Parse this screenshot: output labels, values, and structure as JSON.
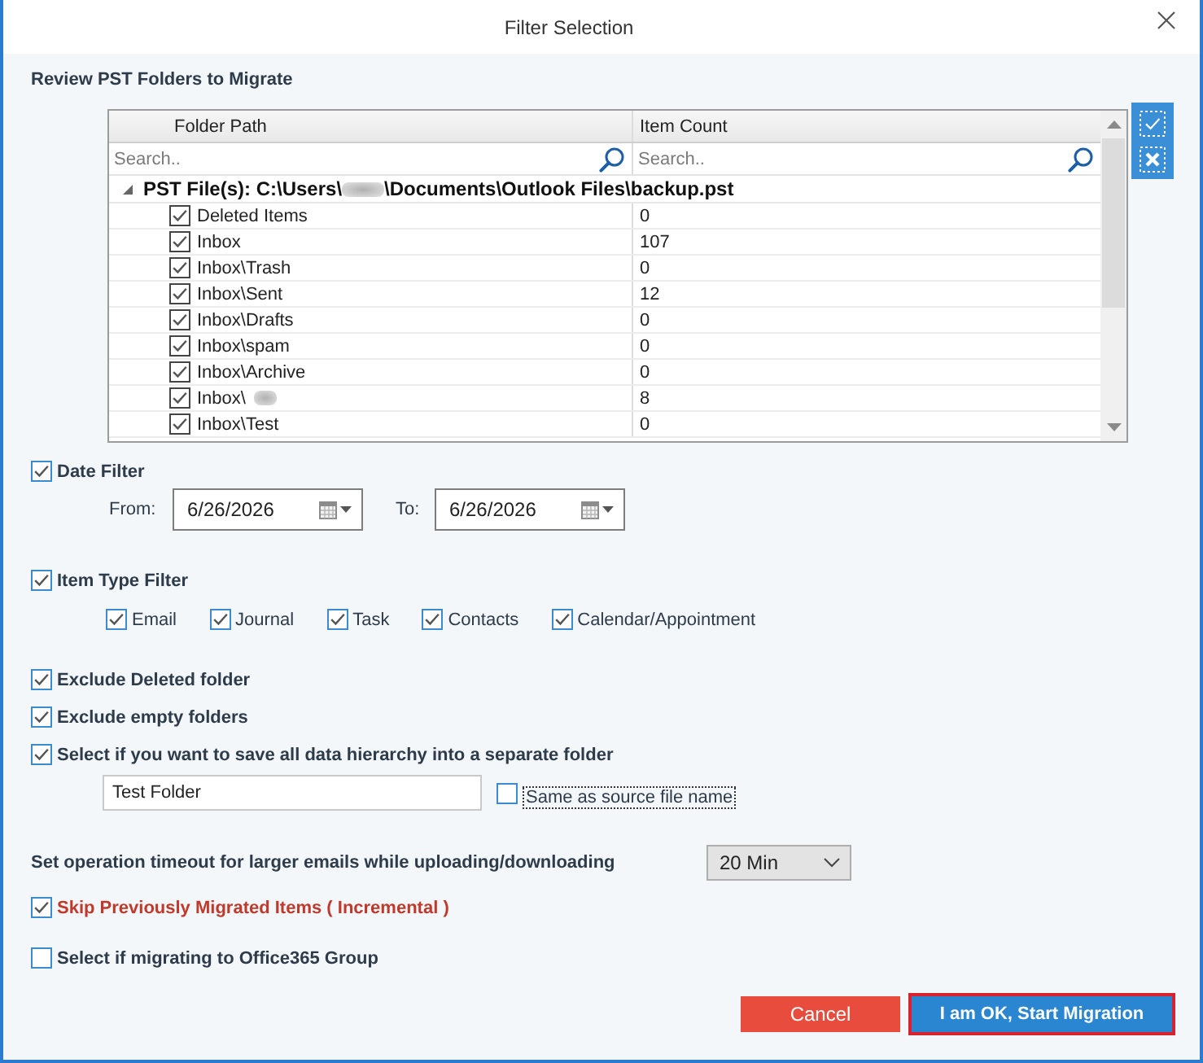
{
  "dialog": {
    "title": "Filter Selection"
  },
  "folders": {
    "heading": "Review PST Folders to Migrate",
    "columns": [
      "Folder Path",
      "Item Count"
    ],
    "search_placeholders": [
      "Search..",
      "Search.."
    ],
    "tree": {
      "expanded": true,
      "path_start": "PST File(s): C:\\Users\\",
      "blurred": true,
      "path_end": "\\Documents\\Outlook Files\\backup.pst",
      "children": [
        {
          "name": "Deleted Items",
          "count": "0",
          "checked": true,
          "blurred": false
        },
        {
          "name": "Inbox",
          "count": "107",
          "checked": true,
          "blurred": false
        },
        {
          "name": "Inbox\\Trash",
          "count": "0",
          "checked": true,
          "blurred": false
        },
        {
          "name": "Inbox\\Sent",
          "count": "12",
          "checked": true,
          "blurred": false
        },
        {
          "name": "Inbox\\Drafts",
          "count": "0",
          "checked": true,
          "blurred": false
        },
        {
          "name": "Inbox\\spam",
          "count": "0",
          "checked": true,
          "blurred": false
        },
        {
          "name": "Inbox\\Archive",
          "count": "0",
          "checked": true,
          "blurred": false
        },
        {
          "name": "Inbox\\",
          "count": "8",
          "checked": true,
          "blurred": true
        },
        {
          "name": "Inbox\\Test",
          "count": "0",
          "checked": true,
          "blurred": false
        }
      ]
    }
  },
  "date_filter": {
    "label": "Date Filter",
    "checked": true,
    "from_label": "From:",
    "from": "6/26/2026",
    "to_label": "To:",
    "to": "6/26/2026"
  },
  "item_type_filter": {
    "label": "Item Type Filter",
    "checked": true,
    "types": [
      {
        "label": "Email",
        "checked": true
      },
      {
        "label": "Journal",
        "checked": true
      },
      {
        "label": "Task",
        "checked": true
      },
      {
        "label": "Contacts",
        "checked": true
      },
      {
        "label": "Calendar/Appointment",
        "checked": true
      }
    ]
  },
  "options": [
    {
      "label": "Exclude Deleted folder",
      "checked": true
    },
    {
      "label": "Exclude empty folders",
      "checked": true
    },
    {
      "label": "Select if you want to save all data hierarchy into a separate folder",
      "checked": true
    }
  ],
  "folder_name": {
    "value": "Test Folder",
    "same_as_source": {
      "label": "Same as source file name",
      "checked": false,
      "focused": true
    }
  },
  "timeout": {
    "label": "Set operation timeout for larger emails while uploading/downloading",
    "value": "20 Min"
  },
  "incremental": {
    "label": "Skip Previously Migrated Items ( Incremental )",
    "checked": true,
    "emphasized": true
  },
  "office365_group": {
    "label": "Select if migrating to Office365 Group",
    "checked": false
  },
  "buttons": [
    {
      "label": "Cancel",
      "kind": "cancel",
      "focused": false
    },
    {
      "label": "I am OK, Start Migration",
      "kind": "primary",
      "focused": true
    }
  ]
}
